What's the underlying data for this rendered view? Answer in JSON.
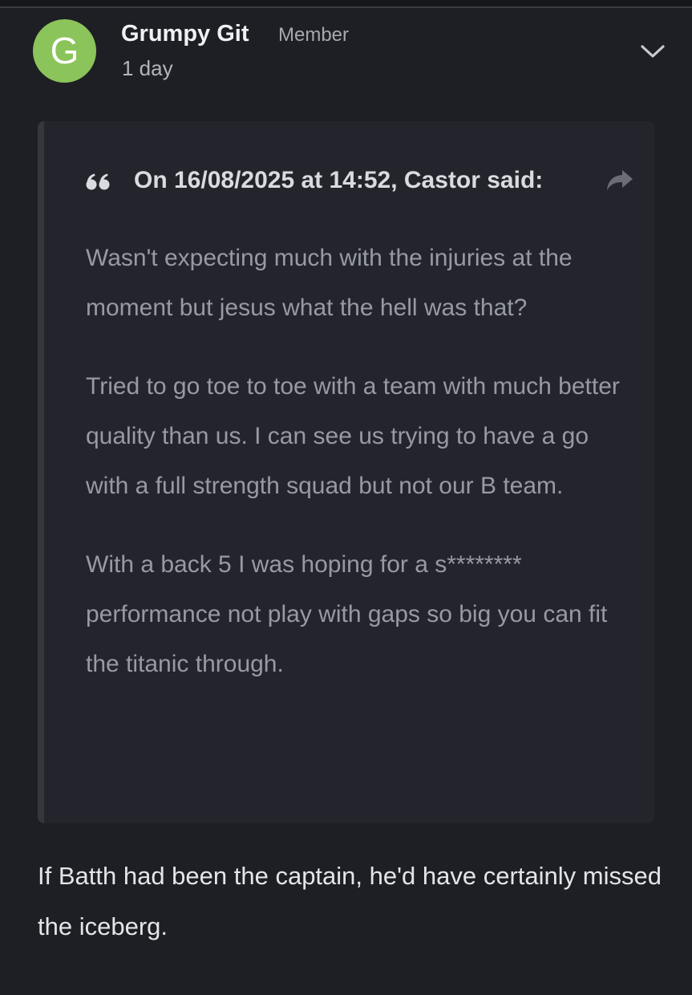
{
  "post": {
    "avatar_letter": "G",
    "avatar_color": "#8bc45a",
    "author": "Grumpy Git",
    "role": "Member",
    "time": "1 day",
    "menu_icon": "chevron-down-icon",
    "quote": {
      "icon": "quote-marks-icon",
      "citation": "On 16/08/2025 at 14:52, Castor said:",
      "share_icon": "share-arrow-icon",
      "paragraphs": [
        "Wasn't expecting much with the injuries at the moment but jesus what the hell was that?",
        "Tried to go toe to toe with a team with much better quality than us. I can see us trying to have a go with a full strength squad but not our B team.",
        "With a back 5 I was hoping for a s******** performance not play with gaps so big you can fit the titanic through."
      ]
    },
    "reply": "If Batth had been the captain, he'd have certainly missed the iceberg."
  }
}
